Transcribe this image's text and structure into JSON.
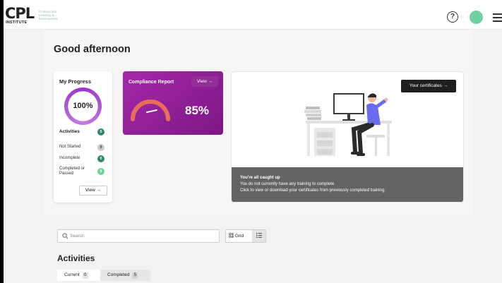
{
  "header": {
    "logo_main": "CPL",
    "logo_institute": "INSTITUTE",
    "logo_tagline": "Professional Learning & Development",
    "help_label": "?",
    "colors": {
      "avatar": "#6fd0a0",
      "accent_green": "#2e8a69"
    },
    "icons": {
      "help": "question-circle-icon",
      "menu": "hamburger-menu-icon"
    }
  },
  "main": {
    "greeting": "Good afternoon"
  },
  "progress": {
    "title": "My Progress",
    "percent_label": "100%",
    "percent_value": 1.0,
    "activities_label": "Activities",
    "activities_count": "5",
    "stats": [
      {
        "label": "Not Started",
        "count": "0"
      },
      {
        "label": "Incomplete",
        "count": "0"
      },
      {
        "label": "Completed or Passed",
        "count": "5"
      }
    ],
    "view_label": "View →",
    "colors": {
      "ring": "#9b36c6"
    }
  },
  "compliance": {
    "title": "Compliance Report",
    "view_label": "View →",
    "percent_label": "85%",
    "percent_value": 0.85,
    "colors": {
      "card": "#9a22a0",
      "gauge": "#e86d5a"
    }
  },
  "certificates": {
    "button_label": "Your certificates →",
    "status_title": "You're all caught up",
    "status_line1": "You do not currently have any training to complete.",
    "status_line2": "Click to view or download your certificates from previously completed training."
  },
  "search": {
    "placeholder": "Search",
    "value": ""
  },
  "view_toggle": {
    "grid_label": "Grid",
    "list_icon": "list-icon",
    "grid_icon": "grid-icon"
  },
  "activities": {
    "title": "Activities",
    "tabs": [
      {
        "label": "Current",
        "count": "0"
      },
      {
        "label": "Completed",
        "count": "5"
      }
    ]
  }
}
